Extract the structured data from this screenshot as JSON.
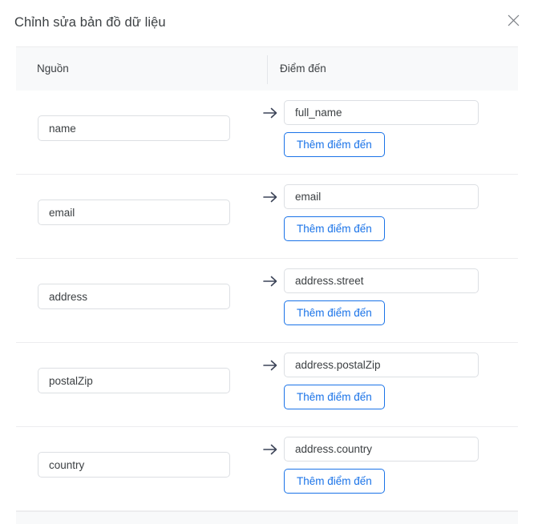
{
  "dialog": {
    "title": "Chỉnh sửa bản đồ dữ liệu",
    "close_icon": "close-icon"
  },
  "table": {
    "headers": {
      "source": "Nguồn",
      "target": "Điểm đến"
    },
    "add_target_label": "Thêm điểm đến",
    "arrow_icon": "arrow-right-icon",
    "rows": [
      {
        "source": "name",
        "target": "full_name"
      },
      {
        "source": "email",
        "target": "email"
      },
      {
        "source": "address",
        "target": "address.street"
      },
      {
        "source": "postalZip",
        "target": "address.postalZip"
      },
      {
        "source": "country",
        "target": "address.country"
      }
    ]
  },
  "colors": {
    "accent": "#1a73e8",
    "text": "#3c4043",
    "border": "#dcdfe3",
    "band": "#f8f9fa"
  }
}
